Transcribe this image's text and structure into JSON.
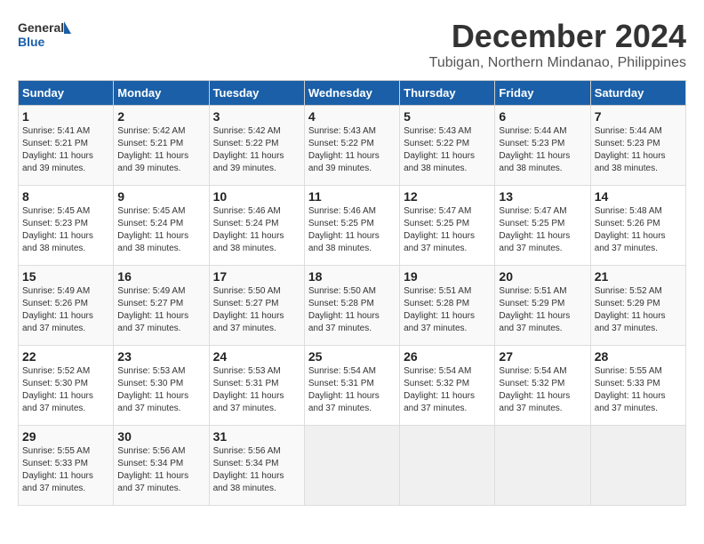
{
  "header": {
    "logo_line1": "General",
    "logo_line2": "Blue",
    "month": "December 2024",
    "location": "Tubigan, Northern Mindanao, Philippines"
  },
  "weekdays": [
    "Sunday",
    "Monday",
    "Tuesday",
    "Wednesday",
    "Thursday",
    "Friday",
    "Saturday"
  ],
  "weeks": [
    [
      {
        "day": "1",
        "sunrise": "5:41 AM",
        "sunset": "5:21 PM",
        "daylight": "11 hours and 39 minutes."
      },
      {
        "day": "2",
        "sunrise": "5:42 AM",
        "sunset": "5:21 PM",
        "daylight": "11 hours and 39 minutes."
      },
      {
        "day": "3",
        "sunrise": "5:42 AM",
        "sunset": "5:22 PM",
        "daylight": "11 hours and 39 minutes."
      },
      {
        "day": "4",
        "sunrise": "5:43 AM",
        "sunset": "5:22 PM",
        "daylight": "11 hours and 39 minutes."
      },
      {
        "day": "5",
        "sunrise": "5:43 AM",
        "sunset": "5:22 PM",
        "daylight": "11 hours and 38 minutes."
      },
      {
        "day": "6",
        "sunrise": "5:44 AM",
        "sunset": "5:23 PM",
        "daylight": "11 hours and 38 minutes."
      },
      {
        "day": "7",
        "sunrise": "5:44 AM",
        "sunset": "5:23 PM",
        "daylight": "11 hours and 38 minutes."
      }
    ],
    [
      {
        "day": "8",
        "sunrise": "5:45 AM",
        "sunset": "5:23 PM",
        "daylight": "11 hours and 38 minutes."
      },
      {
        "day": "9",
        "sunrise": "5:45 AM",
        "sunset": "5:24 PM",
        "daylight": "11 hours and 38 minutes."
      },
      {
        "day": "10",
        "sunrise": "5:46 AM",
        "sunset": "5:24 PM",
        "daylight": "11 hours and 38 minutes."
      },
      {
        "day": "11",
        "sunrise": "5:46 AM",
        "sunset": "5:25 PM",
        "daylight": "11 hours and 38 minutes."
      },
      {
        "day": "12",
        "sunrise": "5:47 AM",
        "sunset": "5:25 PM",
        "daylight": "11 hours and 37 minutes."
      },
      {
        "day": "13",
        "sunrise": "5:47 AM",
        "sunset": "5:25 PM",
        "daylight": "11 hours and 37 minutes."
      },
      {
        "day": "14",
        "sunrise": "5:48 AM",
        "sunset": "5:26 PM",
        "daylight": "11 hours and 37 minutes."
      }
    ],
    [
      {
        "day": "15",
        "sunrise": "5:49 AM",
        "sunset": "5:26 PM",
        "daylight": "11 hours and 37 minutes."
      },
      {
        "day": "16",
        "sunrise": "5:49 AM",
        "sunset": "5:27 PM",
        "daylight": "11 hours and 37 minutes."
      },
      {
        "day": "17",
        "sunrise": "5:50 AM",
        "sunset": "5:27 PM",
        "daylight": "11 hours and 37 minutes."
      },
      {
        "day": "18",
        "sunrise": "5:50 AM",
        "sunset": "5:28 PM",
        "daylight": "11 hours and 37 minutes."
      },
      {
        "day": "19",
        "sunrise": "5:51 AM",
        "sunset": "5:28 PM",
        "daylight": "11 hours and 37 minutes."
      },
      {
        "day": "20",
        "sunrise": "5:51 AM",
        "sunset": "5:29 PM",
        "daylight": "11 hours and 37 minutes."
      },
      {
        "day": "21",
        "sunrise": "5:52 AM",
        "sunset": "5:29 PM",
        "daylight": "11 hours and 37 minutes."
      }
    ],
    [
      {
        "day": "22",
        "sunrise": "5:52 AM",
        "sunset": "5:30 PM",
        "daylight": "11 hours and 37 minutes."
      },
      {
        "day": "23",
        "sunrise": "5:53 AM",
        "sunset": "5:30 PM",
        "daylight": "11 hours and 37 minutes."
      },
      {
        "day": "24",
        "sunrise": "5:53 AM",
        "sunset": "5:31 PM",
        "daylight": "11 hours and 37 minutes."
      },
      {
        "day": "25",
        "sunrise": "5:54 AM",
        "sunset": "5:31 PM",
        "daylight": "11 hours and 37 minutes."
      },
      {
        "day": "26",
        "sunrise": "5:54 AM",
        "sunset": "5:32 PM",
        "daylight": "11 hours and 37 minutes."
      },
      {
        "day": "27",
        "sunrise": "5:54 AM",
        "sunset": "5:32 PM",
        "daylight": "11 hours and 37 minutes."
      },
      {
        "day": "28",
        "sunrise": "5:55 AM",
        "sunset": "5:33 PM",
        "daylight": "11 hours and 37 minutes."
      }
    ],
    [
      {
        "day": "29",
        "sunrise": "5:55 AM",
        "sunset": "5:33 PM",
        "daylight": "11 hours and 37 minutes."
      },
      {
        "day": "30",
        "sunrise": "5:56 AM",
        "sunset": "5:34 PM",
        "daylight": "11 hours and 37 minutes."
      },
      {
        "day": "31",
        "sunrise": "5:56 AM",
        "sunset": "5:34 PM",
        "daylight": "11 hours and 38 minutes."
      },
      null,
      null,
      null,
      null
    ]
  ]
}
